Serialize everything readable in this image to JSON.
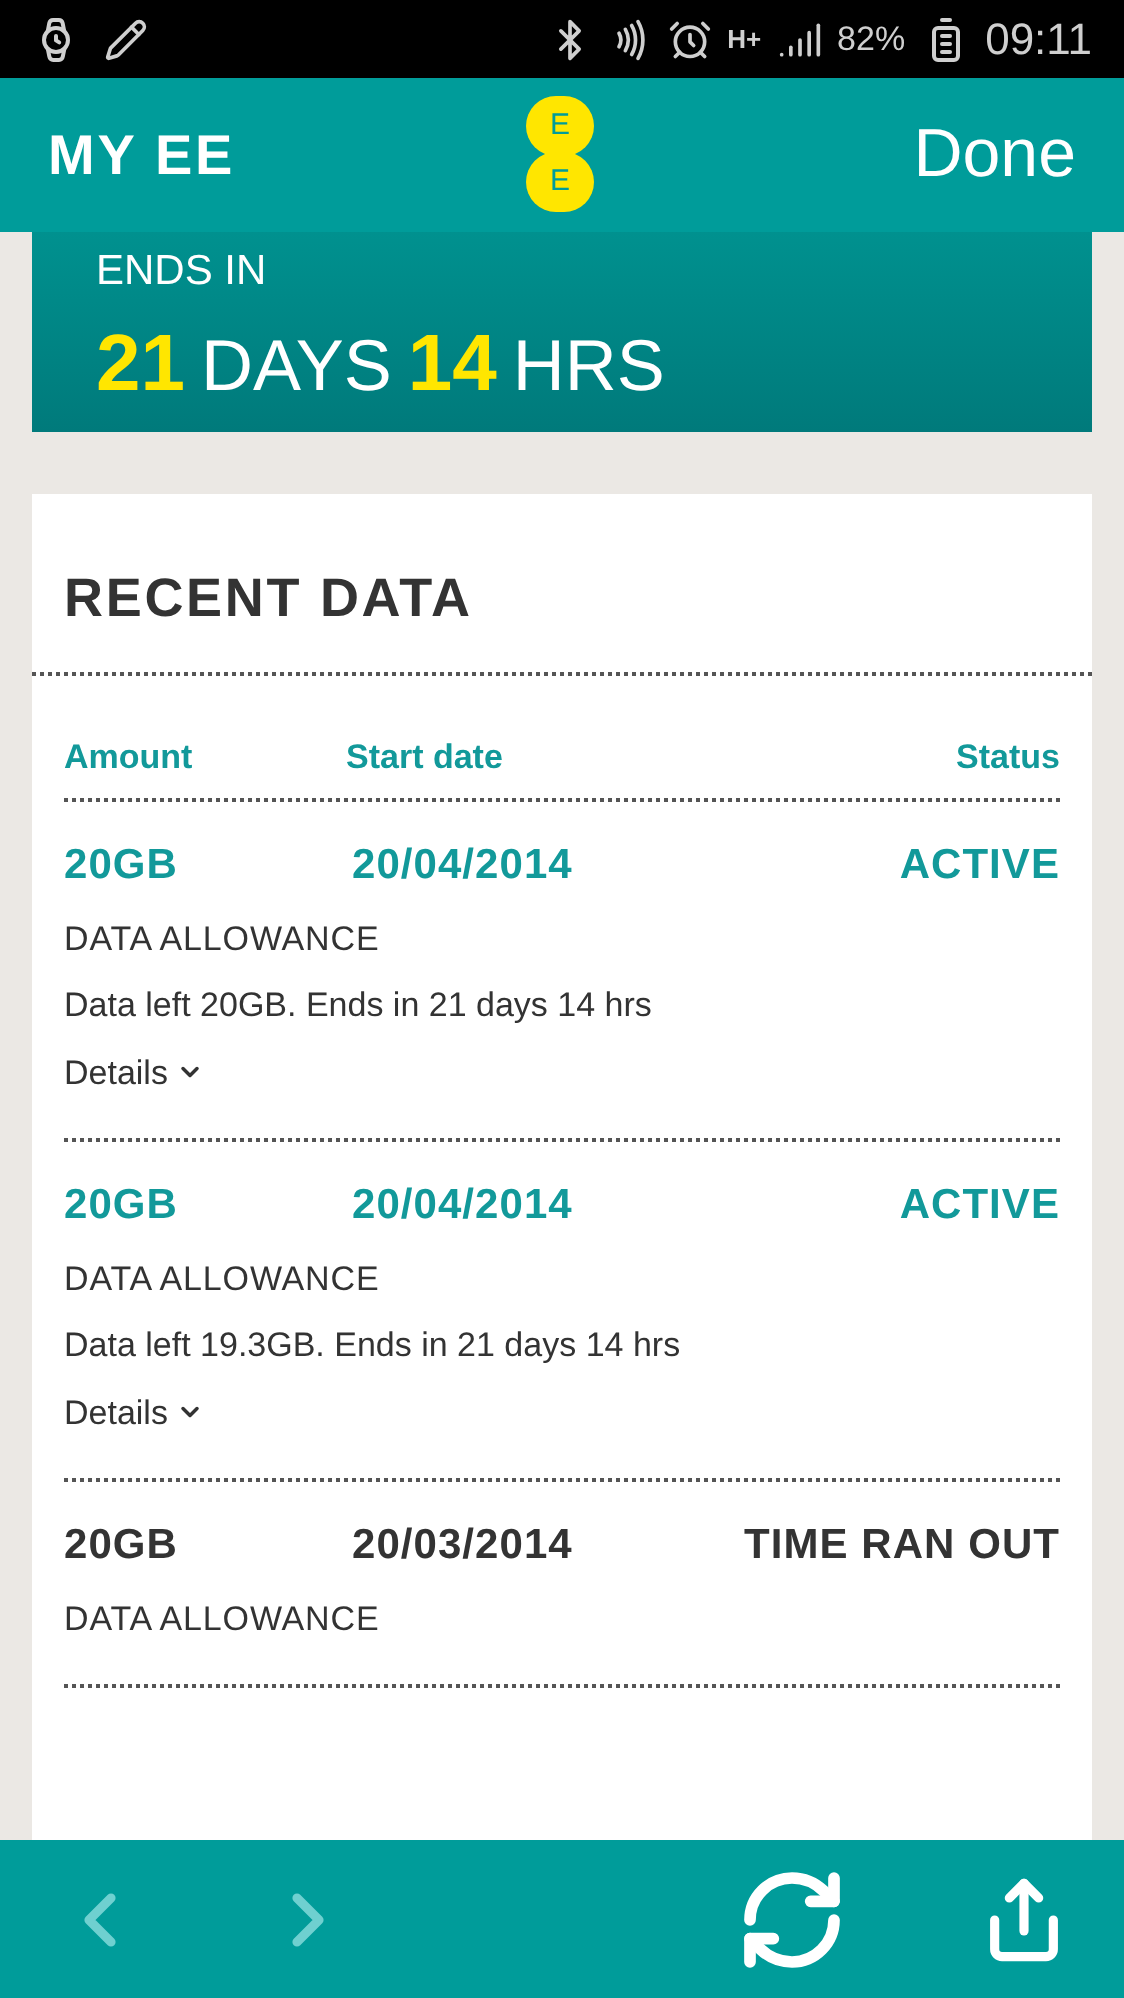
{
  "status_bar": {
    "network": "H+",
    "battery": "82%",
    "time": "09:11"
  },
  "header": {
    "title": "MY EE",
    "logo": [
      "E",
      "E"
    ],
    "action": "Done"
  },
  "plan_card": {
    "label": "ENDS IN",
    "days": "21",
    "days_unit": "DAYS",
    "hours": "14",
    "hours_unit": "HRS"
  },
  "recent_data": {
    "title": "RECENT DATA",
    "columns": [
      "Amount",
      "Start date",
      "Status"
    ],
    "rows": [
      {
        "kind": "active",
        "amount": "20GB",
        "start_date": "20/04/2014",
        "status": "ACTIVE",
        "type": "DATA ALLOWANCE",
        "description": "Data left 20GB. Ends in 21 days 14 hrs",
        "details": "Details"
      },
      {
        "kind": "active",
        "amount": "20GB",
        "start_date": "20/04/2014",
        "status": "ACTIVE",
        "type": "DATA ALLOWANCE",
        "description": "Data left 19.3GB. Ends in 21 days 14 hrs",
        "details": "Details"
      },
      {
        "kind": "expired",
        "amount": "20GB",
        "start_date": "20/03/2014",
        "status": "TIME RAN OUT",
        "type": "DATA ALLOWANCE"
      }
    ]
  }
}
